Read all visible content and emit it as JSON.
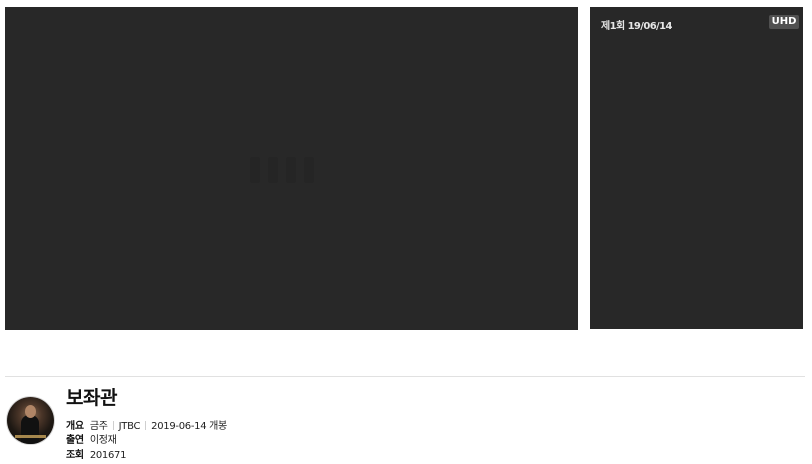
{
  "player": {
    "episode_label": "제1회",
    "episode_date": "19/06/14",
    "quality_badge": "UHD"
  },
  "program": {
    "title": "보좌관",
    "overview_key": "개요",
    "overview": {
      "day": "금주",
      "channel": "JTBC",
      "premiere": "2019-06-14 개봉"
    },
    "cast_key": "출연",
    "cast": "이정재",
    "views_key": "조회",
    "views": "201671"
  }
}
